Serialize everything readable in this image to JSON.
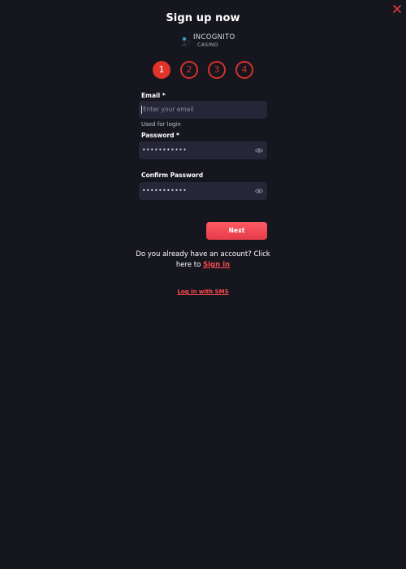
{
  "header": {
    "title": "Sign up now",
    "close_icon": "close-icon"
  },
  "logo": {
    "top": "INCOGNITO",
    "bottom": "CASINO"
  },
  "steps": [
    {
      "label": "1",
      "active": true
    },
    {
      "label": "2",
      "active": false
    },
    {
      "label": "3",
      "active": false
    },
    {
      "label": "4",
      "active": false
    }
  ],
  "form": {
    "email": {
      "label": "Email *",
      "placeholder": "Enter your email",
      "value": "",
      "hint": "Used for login"
    },
    "password": {
      "label": "Password *",
      "value": "•••••••••••",
      "icon": "eye-icon"
    },
    "confirm_password": {
      "label": "Confirm Password",
      "value": "•••••••••••",
      "icon": "eye-icon"
    },
    "next_label": "Next"
  },
  "footer": {
    "account_text_line1": "Do you already have an account? Click",
    "account_text_line2": "here to ",
    "sign_in_label": "Sign in",
    "sms_label": "Log in with SMS"
  },
  "colors": {
    "background": "#16161f",
    "input_bg": "#262638",
    "accent": "#e0342b",
    "link": "#ff4a4a"
  }
}
